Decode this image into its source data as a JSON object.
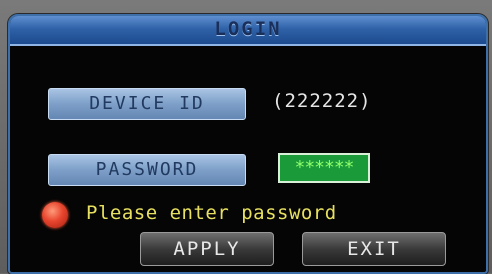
{
  "dialog": {
    "title": "LOGIN"
  },
  "device_id": {
    "label": "DEVICE ID",
    "value": "(222222)"
  },
  "password": {
    "label": "PASSWORD",
    "value": "******"
  },
  "status": {
    "icon": "red-indicator-icon",
    "message": "Please enter password"
  },
  "buttons": {
    "apply_label": "APPLY",
    "exit_label": "EXIT"
  },
  "colors": {
    "title_bar": "#2f62a8",
    "label_button": "#7d9fc8",
    "password_field": "#1b9a3a",
    "status_text": "#e8e060",
    "status_indicator": "#e8452e"
  }
}
